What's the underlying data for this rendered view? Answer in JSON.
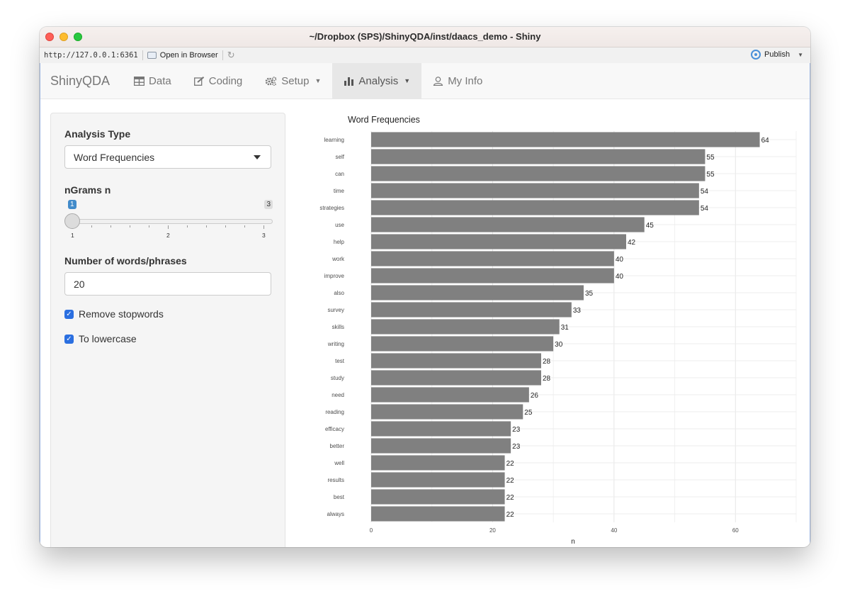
{
  "window": {
    "title": "~/Dropbox (SPS)/ShinyQDA/inst/daacs_demo - Shiny",
    "url": "http://127.0.0.1:6361",
    "open_in_browser": "Open in Browser",
    "publish": "Publish"
  },
  "navbar": {
    "brand": "ShinyQDA",
    "items": [
      {
        "label": "Data",
        "icon": "table-icon"
      },
      {
        "label": "Coding",
        "icon": "edit-icon"
      },
      {
        "label": "Setup",
        "icon": "gears-icon",
        "dropdown": true
      },
      {
        "label": "Analysis",
        "icon": "bar-chart-icon",
        "dropdown": true,
        "active": true
      },
      {
        "label": "My Info",
        "icon": "user-icon"
      }
    ]
  },
  "sidebar": {
    "analysis_type_label": "Analysis Type",
    "analysis_type_value": "Word Frequencies",
    "ngrams_label": "nGrams n",
    "ngrams": {
      "min": 1,
      "max": 3,
      "value": 1,
      "ticks": [
        "1",
        "2",
        "3"
      ],
      "min_label": "1",
      "max_label": "3"
    },
    "num_words_label": "Number of words/phrases",
    "num_words_value": "20",
    "remove_stopwords_label": "Remove stopwords",
    "remove_stopwords_checked": true,
    "lowercase_label": "To lowercase",
    "lowercase_checked": true
  },
  "chart_data": {
    "type": "bar",
    "orientation": "horizontal",
    "title": "Word Frequencies",
    "xlabel": "n",
    "ylabel": "",
    "categories": [
      "learning",
      "self",
      "can",
      "time",
      "strategies",
      "use",
      "help",
      "work",
      "improve",
      "also",
      "survey",
      "skills",
      "writing",
      "test",
      "study",
      "need",
      "reading",
      "efficacy",
      "better",
      "well",
      "results",
      "best",
      "always"
    ],
    "values": [
      64,
      55,
      55,
      54,
      54,
      45,
      42,
      40,
      40,
      35,
      33,
      31,
      30,
      28,
      28,
      26,
      25,
      23,
      23,
      22,
      22,
      22,
      22
    ],
    "xlim": [
      0,
      70
    ],
    "xticks": [
      0,
      20,
      40,
      60
    ],
    "bar_color": "#808080",
    "grid": true
  }
}
